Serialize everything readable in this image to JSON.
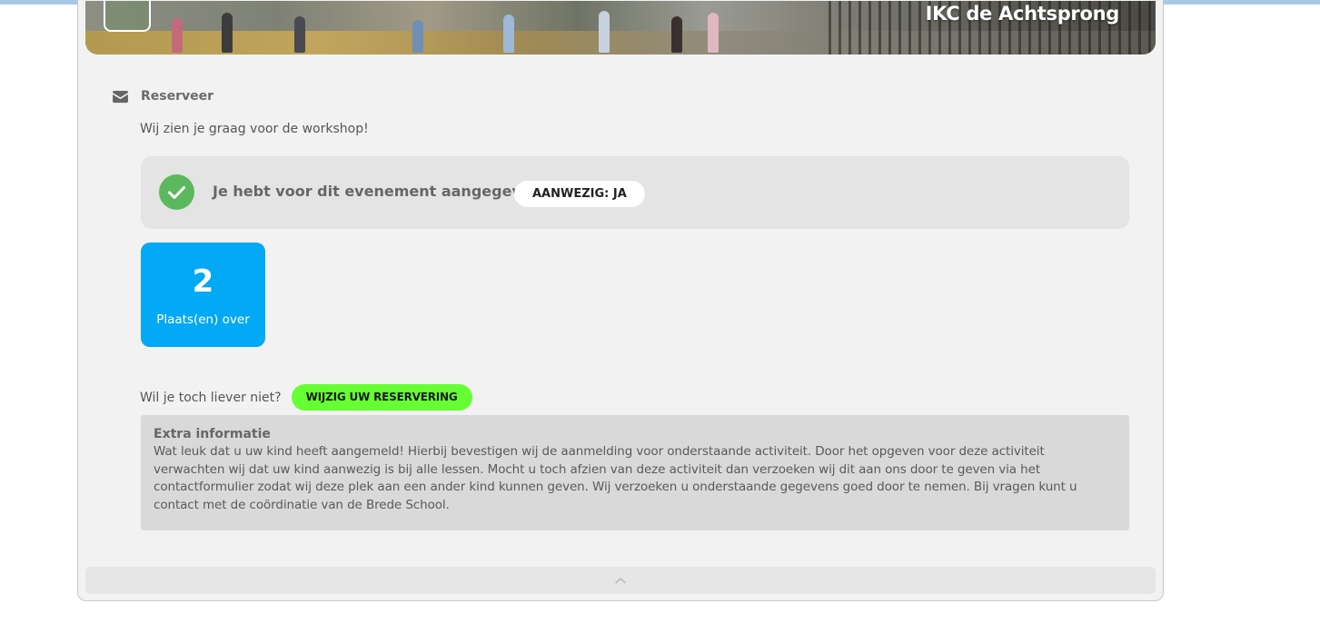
{
  "banner": {
    "school_name": "IKC de Achtsprong"
  },
  "reservation": {
    "section_title": "Reserveer",
    "intro": "Wij zien je graag voor de workshop!",
    "status_text": "Je hebt voor dit evenement aangegeven",
    "status_pill": "AANWEZIG: JA",
    "places_count": "2",
    "places_label": "Plaats(en) over",
    "change_question": "Wil je toch liever niet?",
    "change_button": "WIJZIG UW RESERVERING"
  },
  "extra_info": {
    "title": "Extra informatie",
    "body": "Wat leuk dat u uw kind heeft aangemeld! Hierbij bevestigen wij de aanmelding voor onderstaande activiteit. Door het opgeven voor deze activiteit verwachten wij dat uw kind aanwezig is bij alle lessen. Mocht u toch afzien van deze activiteit dan verzoeken wij dit aan ons door te geven via het contactformulier zodat wij deze plek aan een ander kind kunnen geven. Wij verzoeken u onderstaande gegevens goed door te nemen. Bij vragen kunt u contact met de coördinatie van de Brede School."
  },
  "icons": {
    "section": "envelope-icon",
    "status": "check-circle-icon",
    "collapse": "chevron-up-icon"
  },
  "colors": {
    "places_bg": "#03a9f4",
    "check_green": "#5cb85c",
    "change_button_bg": "#66ff33",
    "card_bg": "#f2f2f2"
  }
}
